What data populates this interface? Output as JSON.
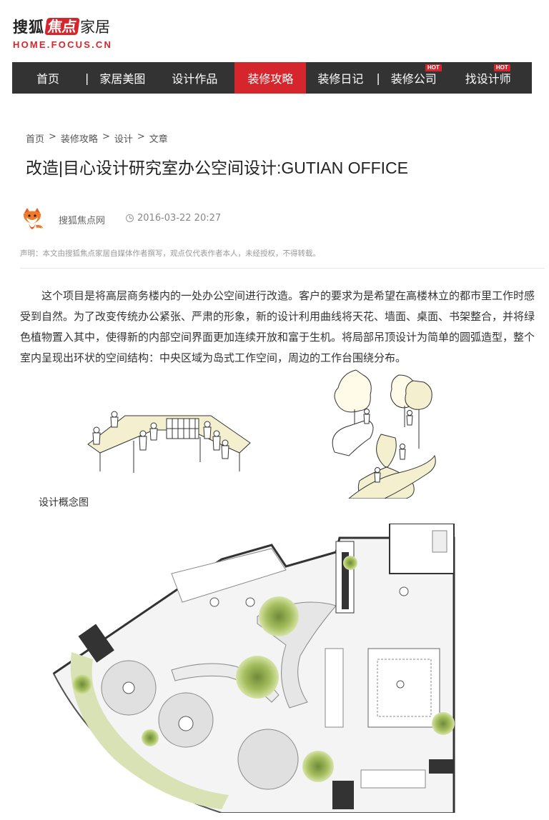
{
  "logo": {
    "cn_part1": "搜狐",
    "cn_part2": "焦点",
    "cn_part3": "家居",
    "en": "HOME.FOCUS.CN"
  },
  "nav": {
    "items": [
      {
        "label": "首页"
      },
      {
        "label": "家居美图"
      },
      {
        "label": "设计作品"
      },
      {
        "label": "装修攻略",
        "active": true
      },
      {
        "label": "装修日记"
      },
      {
        "label": "装修公司",
        "badge": "HOT"
      },
      {
        "label": "找设计师",
        "badge": "HOT"
      }
    ],
    "separator": "|"
  },
  "breadcrumb": {
    "items": [
      "首页",
      "装修攻略",
      "设计",
      "文章"
    ],
    "separator": ">"
  },
  "article": {
    "title": "改造|目心设计研究室办公空间设计:GUTIAN OFFICE",
    "author": "搜狐焦点网",
    "time": "2016-03-22 20:27",
    "notice": "声明：本文由搜狐焦点家居自媒体作者撰写，观点仅代表作者本人，未经授权，不得转载。",
    "paragraph": "这个项目是将高层商务楼内的一处办公空间进行改造。客户的要求为是希望在高楼林立的都市里工作时感受到自然。为了改变传统办公紧张、严肃的形象，新的设计利用曲线将天花、墙面、桌面、书架整合，并将绿色植物置入其中，使得新的内部空间界面更加连续开放和富于生机。将局部吊顶设计为简单的圆弧造型，整个室内呈现出环状的空间结构：中央区域为岛式工作空间，周边的工作台围绕分布。",
    "caption": "设计概念图"
  },
  "colors": {
    "brand_red": "#d6262d",
    "nav_bg": "#333333",
    "plant_green": "#c8d89a",
    "plan_gray": "#e2e2e2"
  },
  "icons": {
    "avatar": "fox-avatar-icon",
    "clock": "clock-icon"
  }
}
